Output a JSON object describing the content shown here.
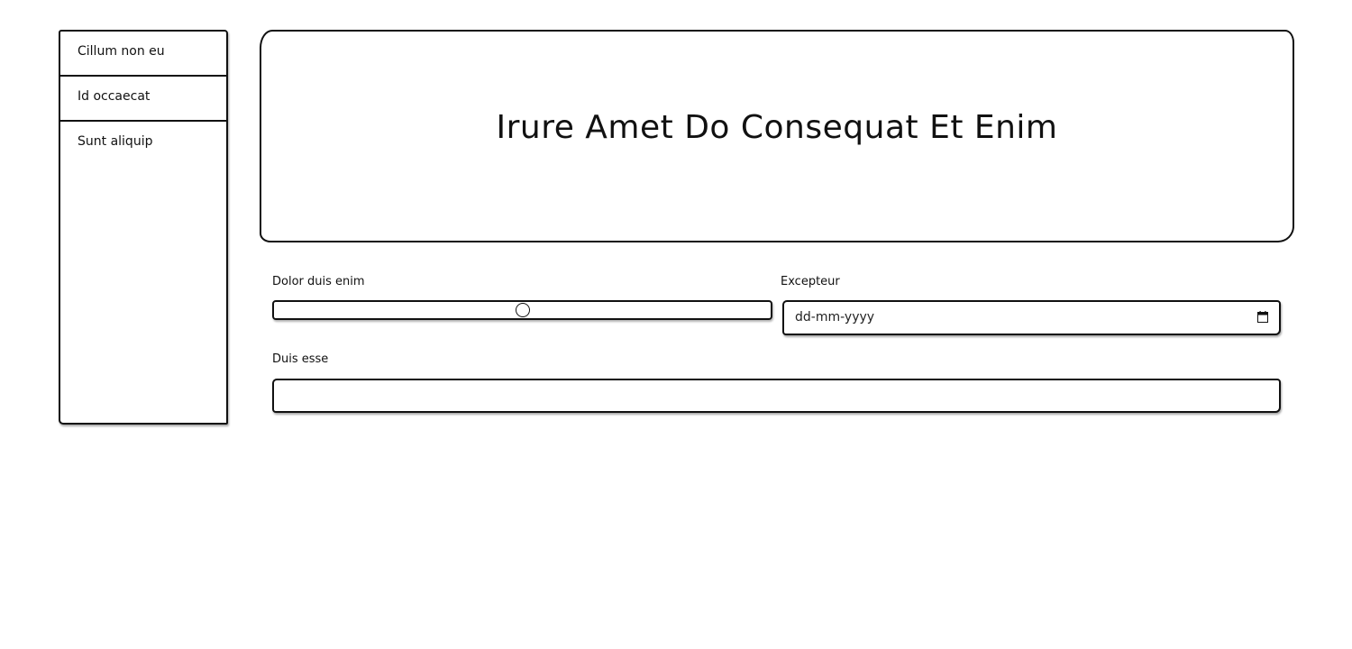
{
  "sidebar": {
    "items": [
      {
        "label": "Cillum non eu"
      },
      {
        "label": "Id occaecat"
      },
      {
        "label": "Sunt aliquip"
      }
    ]
  },
  "hero": {
    "title": "Irure Amet Do Consequat Et Enim"
  },
  "form": {
    "range": {
      "label": "Dolor duis enim",
      "value_fraction": 0.5
    },
    "date": {
      "label": "Excepteur",
      "placeholder": "dd-mm-yyyy",
      "icon": "calendar-icon"
    },
    "text": {
      "label": "Duis esse",
      "value": ""
    }
  }
}
